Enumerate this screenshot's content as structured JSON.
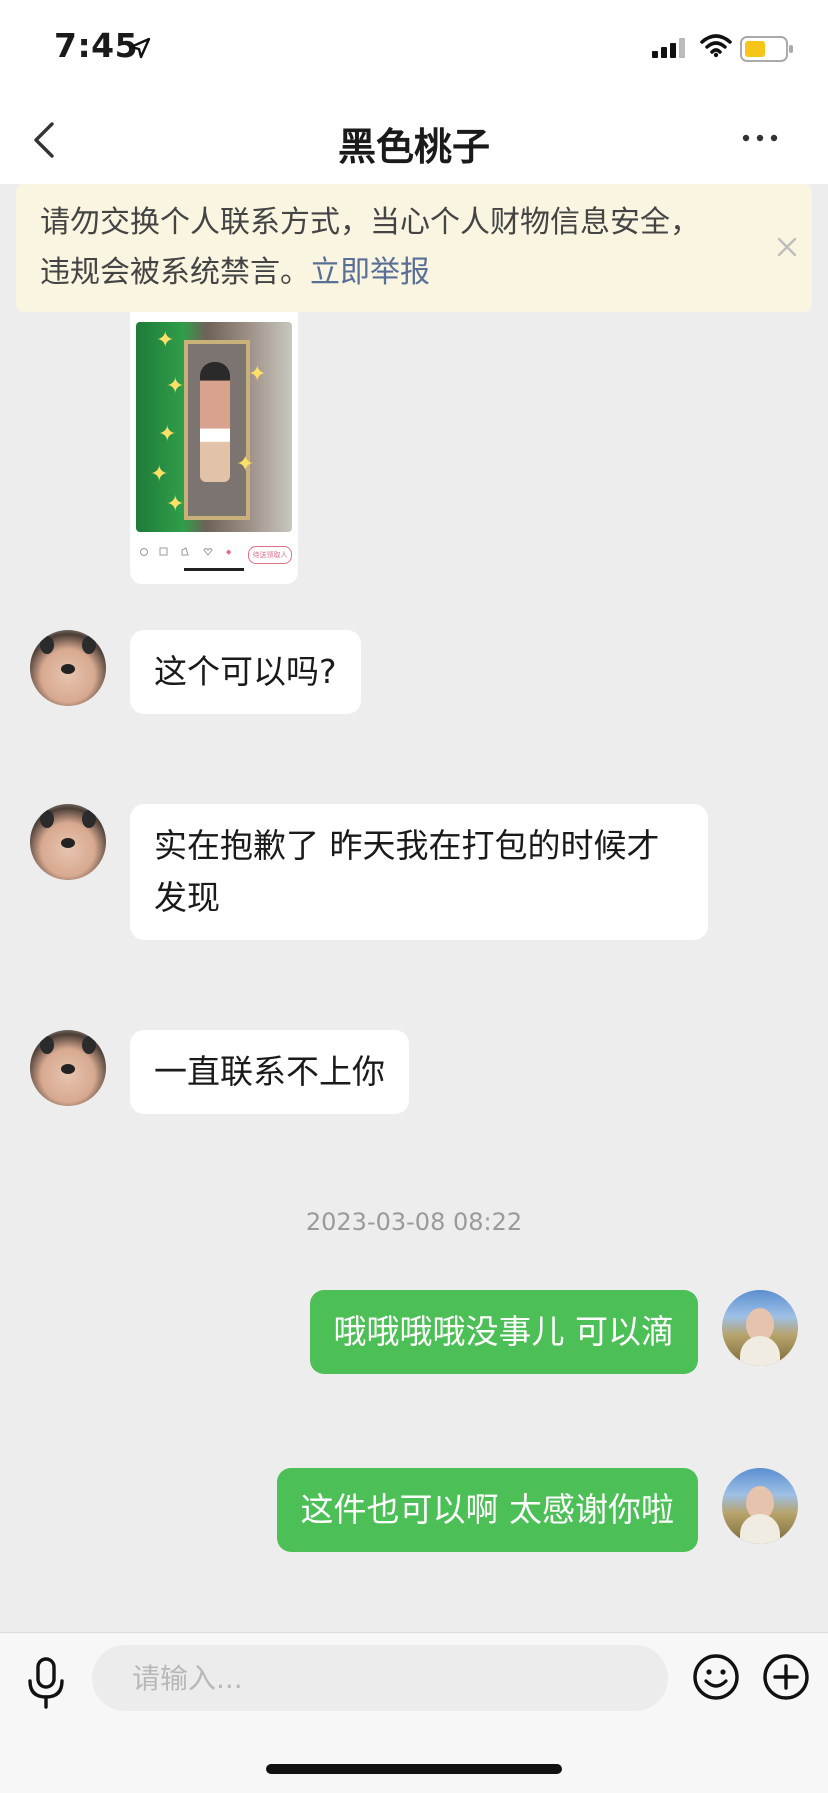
{
  "status_bar": {
    "time": "7:45",
    "icons": [
      "location-arrow-icon",
      "signal-icon",
      "wifi-icon",
      "battery-icon"
    ],
    "battery_color": "#f5c518"
  },
  "nav": {
    "title": "黑色桃子",
    "back_icon": "chevron-left-icon",
    "more_icon": "more-horizontal-icon"
  },
  "notice": {
    "text": "请勿交换个人联系方式，当心个人财物信息安全，违规会被系统禁言。",
    "link": "立即举报",
    "close_icon": "close-icon",
    "background": "#f9f5e0",
    "link_color": "#5a6f96"
  },
  "image_message": {
    "toolbar_button": "待送领取人"
  },
  "messages": [
    {
      "sender": "other",
      "text": "这个可以吗?"
    },
    {
      "sender": "other",
      "text": "实在抱歉了 昨天我在打包的时候才发现"
    },
    {
      "sender": "other",
      "text": "一直联系不上你"
    },
    {
      "sender": "me",
      "text": "哦哦哦哦没事儿 可以滴"
    },
    {
      "sender": "me",
      "text": "这件也可以啊 太感谢你啦"
    }
  ],
  "timestamp": "2023-03-08 08:22",
  "input": {
    "placeholder": "请输入...",
    "value": "",
    "mic_icon": "microphone-icon",
    "emoji_icon": "emoji-icon",
    "plus_icon": "plus-circle-icon"
  },
  "colors": {
    "background": "#ededed",
    "my_bubble": "#4cbf57",
    "other_bubble": "#ffffff",
    "timestamp": "#9a9a9a"
  }
}
